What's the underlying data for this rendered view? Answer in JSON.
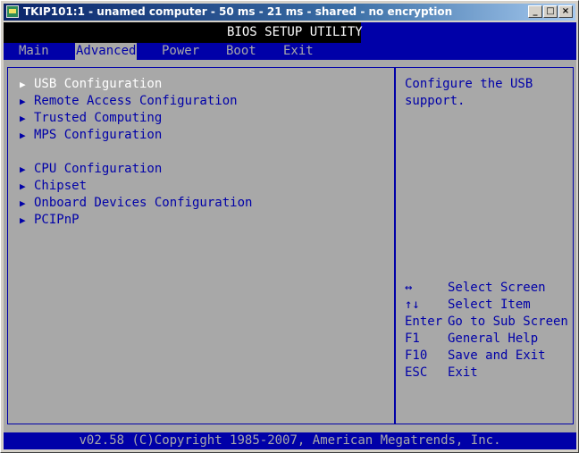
{
  "window": {
    "title": "TKIP101:1 - unamed computer - 50 ms - 21 ms - shared - no encryption",
    "minimize": "_",
    "maximize": "□",
    "close": "×"
  },
  "bios": {
    "title": "BIOS SETUP UTILITY",
    "tabs": [
      {
        "label": "Main"
      },
      {
        "label": "Advanced"
      },
      {
        "label": "Power"
      },
      {
        "label": "Boot"
      },
      {
        "label": "Exit"
      }
    ],
    "active_tab": "Advanced",
    "menu_items": [
      {
        "label": "USB Configuration",
        "selected": true
      },
      {
        "label": "Remote Access Configuration"
      },
      {
        "label": "Trusted Computing"
      },
      {
        "label": "MPS Configuration"
      },
      {
        "label": "CPU Configuration"
      },
      {
        "label": "Chipset"
      },
      {
        "label": "Onboard Devices Configuration"
      },
      {
        "label": "PCIPnP"
      }
    ],
    "arrow_glyph": "▶",
    "help": {
      "line1": "Configure the USB",
      "line2": "support."
    },
    "keys": [
      {
        "key": "↔",
        "action": "Select Screen"
      },
      {
        "key": "↑↓",
        "action": "Select Item"
      },
      {
        "key": "Enter",
        "action": "Go to Sub Screen"
      },
      {
        "key": "F1",
        "action": "General Help"
      },
      {
        "key": "F10",
        "action": "Save and Exit"
      },
      {
        "key": "ESC",
        "action": "Exit"
      }
    ],
    "footer": "v02.58 (C)Copyright 1985-2007, American Megatrends, Inc."
  }
}
